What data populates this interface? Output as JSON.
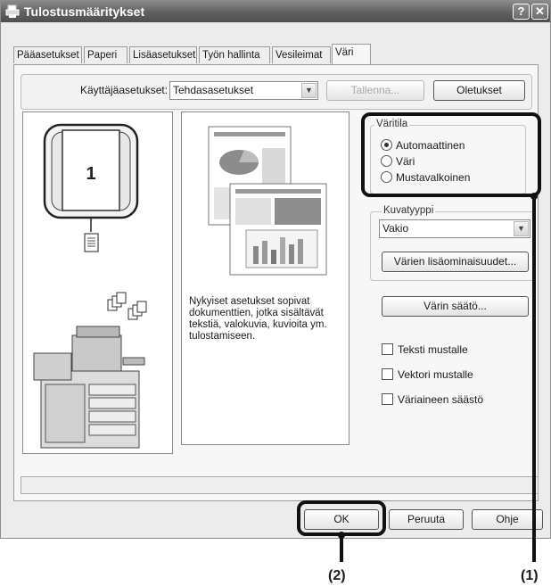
{
  "window": {
    "title": "Tulostusmääritykset",
    "help_glyph": "?",
    "close_glyph": "✕"
  },
  "tabs": [
    {
      "label": "Pääasetukset"
    },
    {
      "label": "Paperi"
    },
    {
      "label": "Lisäasetukset"
    },
    {
      "label": "Työn hallinta"
    },
    {
      "label": "Vesileimat"
    },
    {
      "label": "Väri",
      "active": true
    }
  ],
  "settings_row": {
    "user_settings_label": "Käyttäjäasetukset:",
    "user_settings_value": "Tehdasasetukset",
    "save_label": "Tallenna...",
    "defaults_label": "Oletukset"
  },
  "preview": {
    "page_number": "1",
    "description": "Nykyiset asetukset sopivat dokumenttien, jotka sisältävät tekstiä, valokuvia, kuvioita ym. tulostamiseen."
  },
  "color_mode": {
    "title": "Väritila",
    "options": [
      {
        "label": "Automaattinen",
        "selected": true
      },
      {
        "label": "Väri",
        "selected": false
      },
      {
        "label": "Mustavalkoinen",
        "selected": false
      }
    ]
  },
  "image_type": {
    "title": "Kuvatyyppi",
    "value": "Vakio",
    "advanced_label": "Värien lisäominaisuudet..."
  },
  "color_adjust_label": "Värin säätö...",
  "checkboxes": [
    {
      "label": "Teksti mustalle",
      "checked": false
    },
    {
      "label": "Vektori mustalle",
      "checked": false
    },
    {
      "label": "Väriaineen säästö",
      "checked": false
    }
  ],
  "footer": {
    "ok_label": "OK",
    "cancel_label": "Peruuta",
    "help_label": "Ohje"
  },
  "callouts": {
    "one": "(1)",
    "two": "(2)"
  },
  "colors": {
    "titlebar": "#5f5f5f",
    "panel": "#f7f7f7",
    "callout": "#111111"
  }
}
